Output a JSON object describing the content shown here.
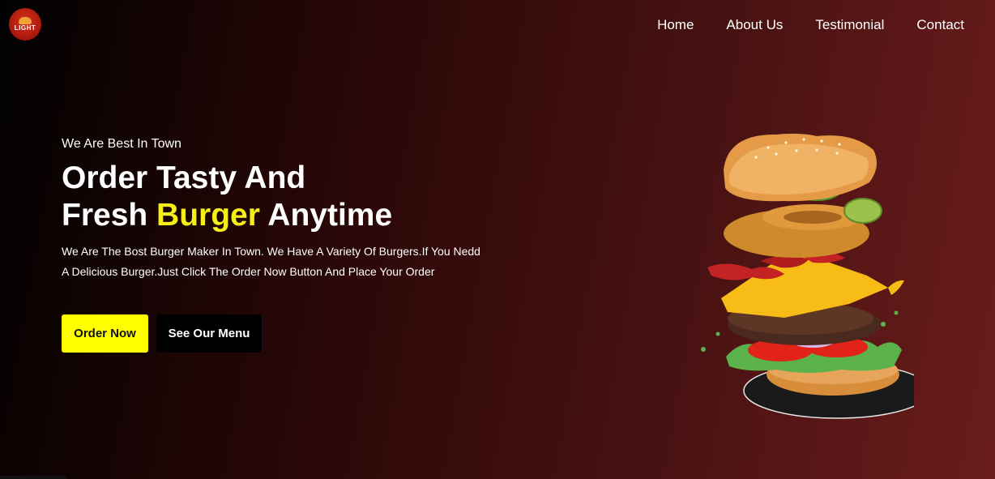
{
  "header": {
    "logo_text": "LIGHT",
    "nav": [
      {
        "label": "Home"
      },
      {
        "label": "About Us"
      },
      {
        "label": "Testimonial"
      },
      {
        "label": "Contact"
      }
    ]
  },
  "hero": {
    "tagline": "We Are Best In Town",
    "title_line1": "Order Tasty And",
    "title_line2_pre": "Fresh ",
    "title_highlight": "Burger",
    "title_line2_post": " Anytime",
    "description_line1": "We Are The Bost Burger Maker In Town. We Have A Variety Of Burgers.If You Nedd",
    "description_line2": "A Delicious Burger.Just Click The Order Now Button And Place Your Order",
    "order_button": "Order Now",
    "menu_button": "See Our Menu"
  },
  "colors": {
    "accent": "#ffff00",
    "background_dark": "#020101",
    "background_red": "#6a1c1c"
  },
  "icons": [
    "burger-logo-icon",
    "burger-image"
  ]
}
